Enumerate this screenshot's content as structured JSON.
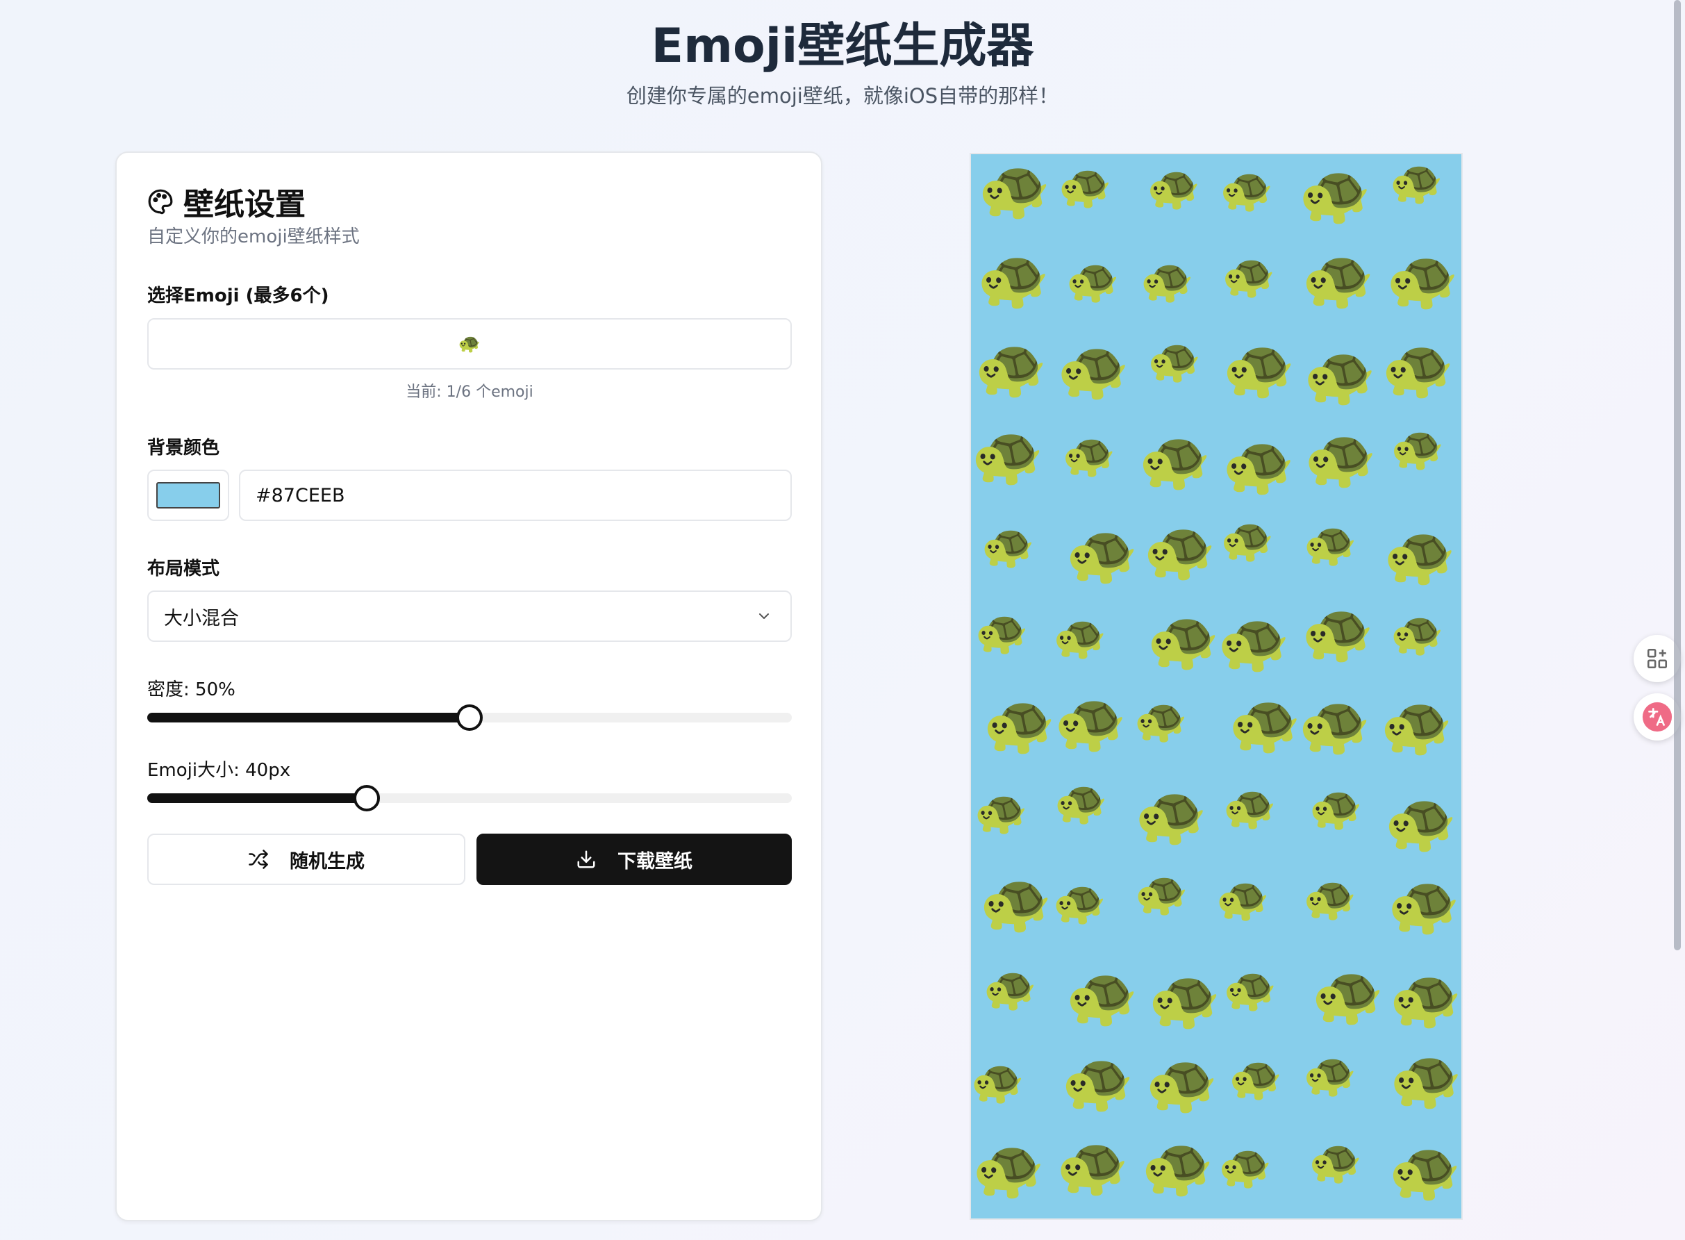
{
  "page": {
    "title": "Emoji壁纸生成器",
    "subtitle": "创建你专属的emoji壁纸，就像iOS自带的那样！"
  },
  "settings": {
    "heading": "壁纸设置",
    "description": "自定义你的emoji壁纸样式",
    "emoji_label": "选择Emoji (最多6个)",
    "emoji_value": "🐢",
    "emoji_count": "当前: 1/6 个emoji",
    "bg_label": "背景颜色",
    "bg_color": "#87CEEB",
    "bg_hex_value": "#87CEEB",
    "layout_label": "布局模式",
    "layout_value": "大小混合",
    "density_label": "密度: 50%",
    "density_value": 50,
    "size_label": "Emoji大小: 40px",
    "size_value": 40,
    "size_fraction": 0.34,
    "random_button": "随机生成",
    "download_button": "下载壁纸"
  },
  "preview": {
    "emoji": "🐢",
    "background": "#87CEEB"
  },
  "icons": {
    "palette": "palette-icon",
    "shuffle": "shuffle-icon",
    "download": "download-icon",
    "chevron": "chevron-down-icon",
    "grid_add": "grid-add-icon",
    "translate": "translate-icon"
  }
}
